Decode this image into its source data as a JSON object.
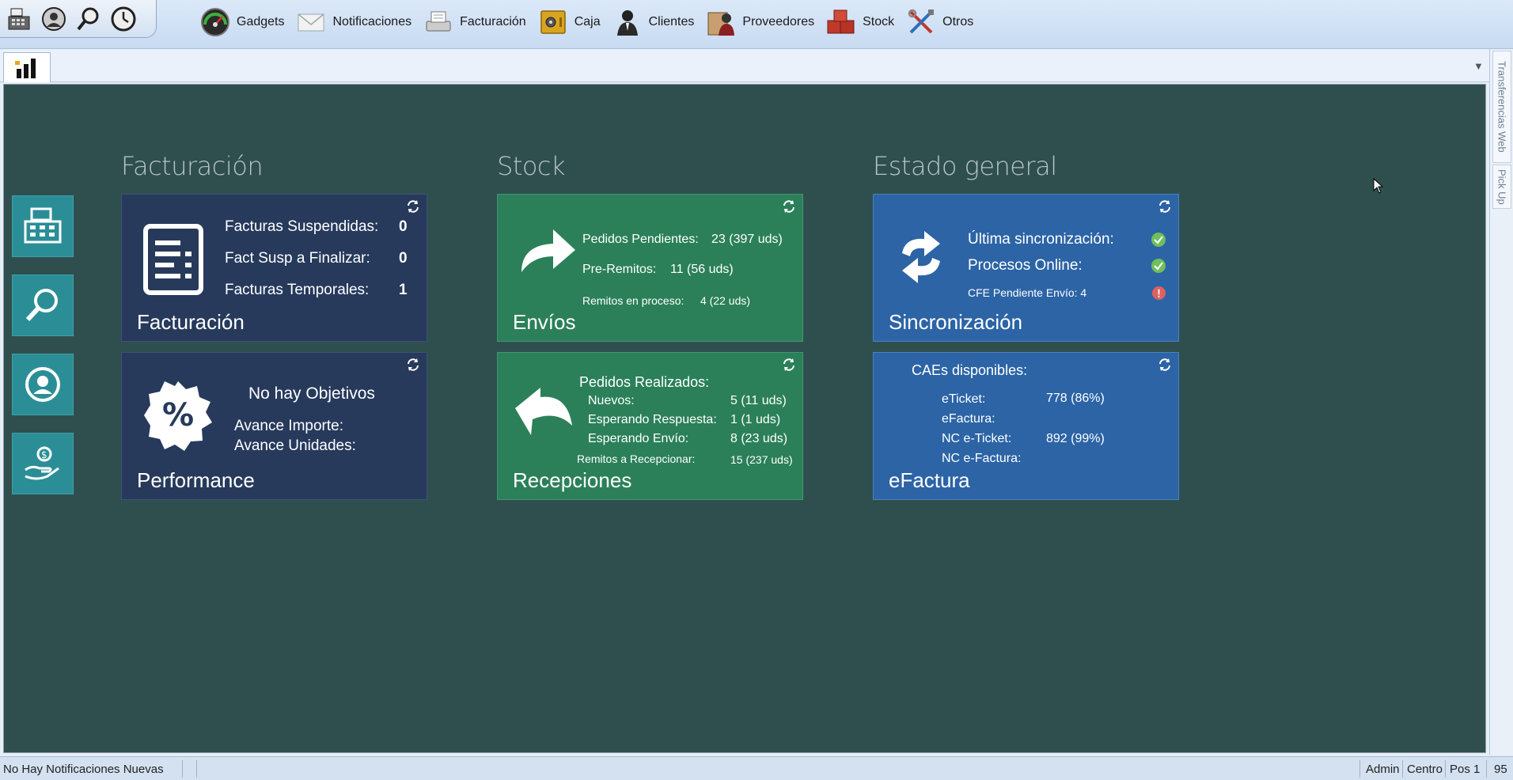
{
  "toolbar": {
    "quick_icons": [
      "cash-register-icon",
      "user-support-icon",
      "search-icon",
      "clock-icon"
    ],
    "menu": [
      {
        "label": "Gadgets",
        "icon": "gauge-icon"
      },
      {
        "label": "Notificaciones",
        "icon": "envelope-icon"
      },
      {
        "label": "Facturación",
        "icon": "printer-icon"
      },
      {
        "label": "Caja",
        "icon": "safe-icon"
      },
      {
        "label": "Clientes",
        "icon": "person-icon"
      },
      {
        "label": "Proveedores",
        "icon": "supplier-icon"
      },
      {
        "label": "Stock",
        "icon": "boxes-icon"
      },
      {
        "label": "Otros",
        "icon": "tools-icon"
      }
    ]
  },
  "side_panel": {
    "tabs": [
      "Transferencias Web",
      "Pick Up"
    ]
  },
  "sections": {
    "facturacion": "Facturación",
    "stock": "Stock",
    "estado": "Estado general"
  },
  "tiles": {
    "facturacion": {
      "title": "Facturación",
      "rows": [
        {
          "label": "Facturas Suspendidas:",
          "value": "0"
        },
        {
          "label": "Fact Susp a Finalizar:",
          "value": "0"
        },
        {
          "label": "Facturas Temporales:",
          "value": "1"
        }
      ]
    },
    "performance": {
      "title": "Performance",
      "message": "No hay Objetivos",
      "rows": [
        "Avance Importe:",
        "Avance Unidades:"
      ]
    },
    "envios": {
      "title": "Envíos",
      "rows": [
        {
          "label": "Pedidos Pendientes:",
          "value": "23 (397 uds)"
        },
        {
          "label": "Pre-Remitos:",
          "value": "11 (56 uds)"
        },
        {
          "label": "Remitos en proceso:",
          "value": "4 (22 uds)"
        }
      ]
    },
    "recepciones": {
      "title": "Recepciones",
      "header": "Pedidos Realizados:",
      "rows": [
        {
          "label": "Nuevos:",
          "value": "5 (11 uds)"
        },
        {
          "label": "Esperando Respuesta:",
          "value": "1 (1 uds)"
        },
        {
          "label": "Esperando Envío:",
          "value": "8 (23 uds)"
        },
        {
          "label": "Remitos a Recepcionar:",
          "value": "15 (237 uds)"
        }
      ]
    },
    "sincronizacion": {
      "title": "Sincronización",
      "rows": [
        {
          "label": "Última sincronización:",
          "status": "ok",
          "color": "#6fbf5a"
        },
        {
          "label": "Procesos Online:",
          "status": "ok",
          "color": "#6fbf5a"
        },
        {
          "label": "CFE Pendiente Envío: 4",
          "status": "error",
          "color": "#e06060"
        }
      ]
    },
    "efactura": {
      "title": "eFactura",
      "header": "CAEs disponibles:",
      "rows": [
        {
          "label": "eTicket:",
          "value": "778 (86%)"
        },
        {
          "label": "eFactura:",
          "value": ""
        },
        {
          "label": "NC e-Ticket:",
          "value": "892 (99%)"
        },
        {
          "label": "NC e-Factura:",
          "value": ""
        }
      ]
    }
  },
  "statusbar": {
    "message": "No Hay Notificaciones Nuevas",
    "user": "Admin",
    "branch": "Centro",
    "pos": "Pos 1",
    "number": "95"
  },
  "colors": {
    "canvas": "#2f4f4f",
    "tile_navy": "#273a5c",
    "tile_green": "#2b8059",
    "tile_blue": "#2c64a6",
    "side_button": "#2b8e96"
  }
}
